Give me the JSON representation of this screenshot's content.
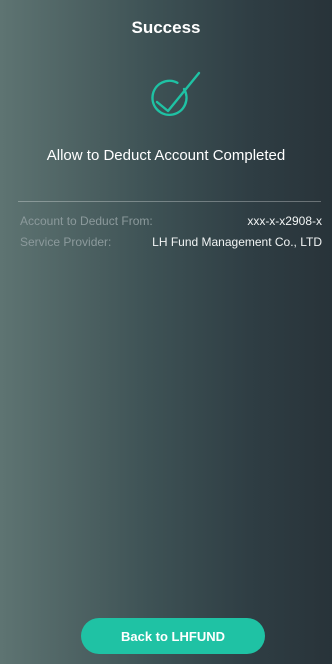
{
  "header": {
    "title": "Success"
  },
  "status": {
    "icon": "success-check-icon",
    "icon_color": "#1fc2a4",
    "heading": "Allow to Deduct Account Completed"
  },
  "details": {
    "account_label": "Account to Deduct From:",
    "account_value": "xxx-x-x2908-x",
    "provider_label": "Service Provider:",
    "provider_value": "LH Fund Management Co., LTD"
  },
  "footer": {
    "back_button_label": "Back to LHFUND",
    "button_color": "#1fc2a4"
  }
}
